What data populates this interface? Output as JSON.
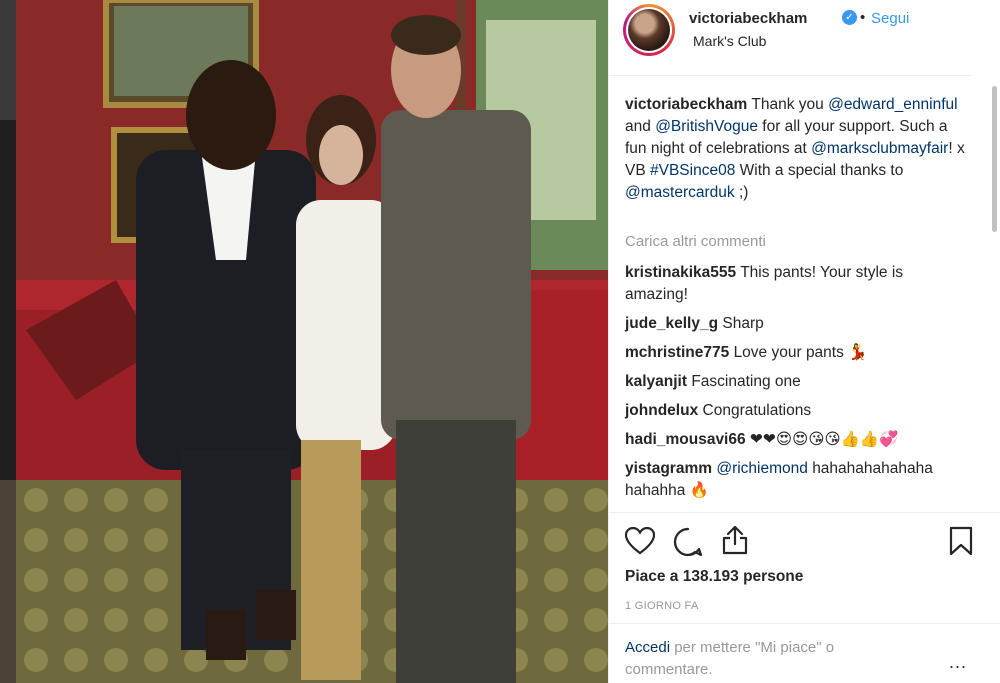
{
  "post": {
    "username": "victoriabeckham",
    "follow_label": "Segui",
    "location": "Mark's Club",
    "caption": {
      "user": "victoriabeckham",
      "t1": "Thank you",
      "m1": "@edward_enninful",
      "t2": "and",
      "m2": "@BritishVogue",
      "t3": "for all your support. Such a fun night of celebrations at",
      "m3": "@marksclubmayfair",
      "t4": "! x VB",
      "h1": "#VBSince08",
      "t5": "With a special thanks to",
      "m4": "@mastercarduk",
      "t6": ";)"
    },
    "load_more": "Carica altri commenti",
    "comments": [
      {
        "user": "kristinakika555",
        "text": "This pants! Your style is amazing!"
      },
      {
        "user": "jude_kelly_g",
        "text": "Sharp"
      },
      {
        "user": "mchristine775",
        "text": "Love your pants 💃"
      },
      {
        "user": "kalyanjit",
        "text": "Fascinating one"
      },
      {
        "user": "johndelux",
        "text": "Congratulations"
      },
      {
        "user": "hadi_mousavi66",
        "text": "❤❤😍😍😘😘👍👍💞"
      },
      {
        "user": "yistagramm",
        "mention": "@richiemond",
        "text": "hahahahahahaha hahahha 🔥"
      }
    ],
    "likes": "Piace a 138.193 persone",
    "time": "1 GIORNO FA",
    "login": {
      "link": "Accedi",
      "text": "per mettere \"Mi piace\" o commentare."
    },
    "more": "..."
  },
  "icons": [
    "heart-icon",
    "comment-icon",
    "share-icon",
    "bookmark-icon",
    "verified-badge-icon"
  ],
  "colors": {
    "link": "#003569",
    "accent": "#3897f0",
    "muted": "#999999"
  }
}
